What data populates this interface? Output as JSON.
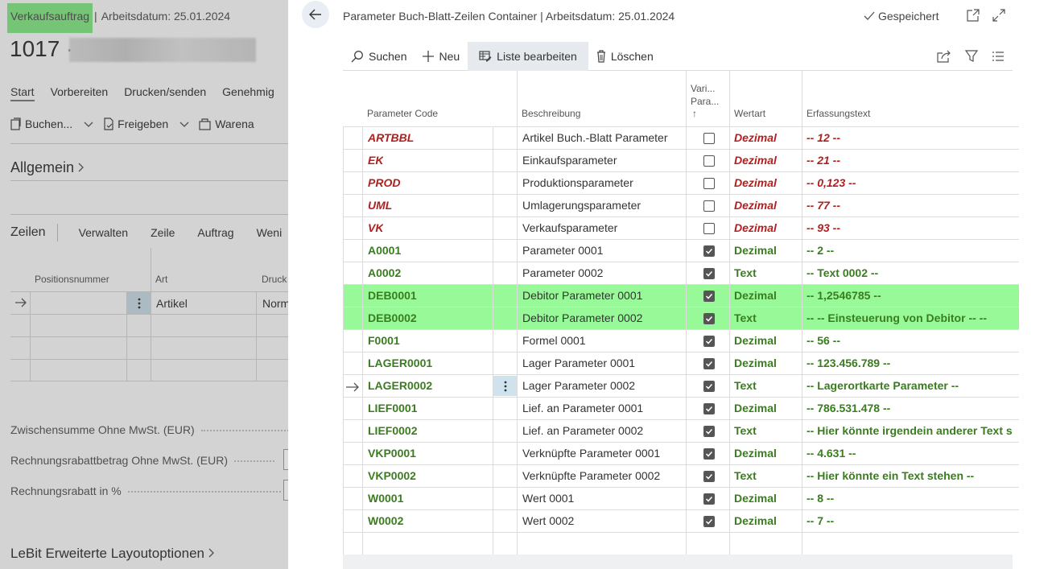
{
  "background": {
    "header_tag": "Verkaufsauftrag",
    "header_rest": "Arbeitsdatum: 25.01.2024",
    "header_sep": "|",
    "doc_number": "1017 ·",
    "tabs": [
      "Start",
      "Vorbereiten",
      "Drucken/senden",
      "Genehmig"
    ],
    "actions": [
      "Buchen...",
      "Freigeben",
      "Warena"
    ],
    "section_general": "Allgemein",
    "lines_title": "Zeilen",
    "lines_actions": [
      "Verwalten",
      "Zeile",
      "Auftrag",
      "Weni"
    ],
    "grid_headers": [
      "Positionsnummer",
      "Art",
      "Druck"
    ],
    "grid_row1_art": "Artikel",
    "grid_row1_druck": "Norm",
    "totals": [
      "Zwischensumme Ohne MwSt. (EUR)",
      "Rechnungsrabattbetrag Ohne MwSt. (EUR)",
      "Rechnungsrabatt in %"
    ],
    "section_layout": "LeBit Erweiterte Layoutoptionen"
  },
  "panel": {
    "title": "Parameter Buch-Blatt-Zeilen Container | Arbeitsdatum: 25.01.2024",
    "saved": "Gespeichert",
    "toolbar": {
      "search": "Suchen",
      "new": "Neu",
      "edit_list": "Liste bearbeiten",
      "delete": "Löschen"
    },
    "columns": {
      "code": "Parameter Code",
      "desc": "Beschreibung",
      "var_line1": "Vari...",
      "var_line2": "Para...",
      "var_sort": "↑",
      "wertart": "Wertart",
      "erfassung": "Erfassungstext"
    },
    "rows": [
      {
        "code": "ARTBBL",
        "desc": "Artikel Buch.-Blatt Parameter",
        "checked": false,
        "wertart": "Dezimal",
        "erf": "-- 12 --",
        "style": "red",
        "selected": false,
        "current": false
      },
      {
        "code": "EK",
        "desc": "Einkaufsparameter",
        "checked": false,
        "wertart": "Dezimal",
        "erf": "-- 21 --",
        "style": "red",
        "selected": false,
        "current": false
      },
      {
        "code": "PROD",
        "desc": "Produktionsparameter",
        "checked": false,
        "wertart": "Dezimal",
        "erf": "-- 0,123 --",
        "style": "red",
        "selected": false,
        "current": false
      },
      {
        "code": "UML",
        "desc": "Umlagerungsparameter",
        "checked": false,
        "wertart": "Dezimal",
        "erf": "-- 77 --",
        "style": "red",
        "selected": false,
        "current": false
      },
      {
        "code": "VK",
        "desc": "Verkaufsparameter",
        "checked": false,
        "wertart": "Dezimal",
        "erf": "-- 93 --",
        "style": "red",
        "selected": false,
        "current": false
      },
      {
        "code": "A0001",
        "desc": "Parameter 0001",
        "checked": true,
        "wertart": "Dezimal",
        "erf": "-- 2 --",
        "style": "green",
        "selected": false,
        "current": false
      },
      {
        "code": "A0002",
        "desc": "Parameter 0002",
        "checked": true,
        "wertart": "Text",
        "erf": "-- Text 0002 --",
        "style": "green",
        "selected": false,
        "current": false
      },
      {
        "code": "DEB0001",
        "desc": "Debitor Parameter 0001",
        "checked": true,
        "wertart": "Dezimal",
        "erf": "-- 1,2546785 --",
        "style": "green",
        "selected": true,
        "current": false
      },
      {
        "code": "DEB0002",
        "desc": "Debitor Parameter 0002",
        "checked": true,
        "wertart": "Text",
        "erf": "-- -- Einsteuerung von Debitor -- --",
        "style": "green",
        "selected": true,
        "current": false
      },
      {
        "code": "F0001",
        "desc": "Formel 0001",
        "checked": true,
        "wertart": "Dezimal",
        "erf": "-- 56 --",
        "style": "green",
        "selected": false,
        "current": false
      },
      {
        "code": "LAGER0001",
        "desc": "Lager Parameter 0001",
        "checked": true,
        "wertart": "Dezimal",
        "erf": "-- 123.456.789 --",
        "style": "green",
        "selected": false,
        "current": false
      },
      {
        "code": "LAGER0002",
        "desc": "Lager Parameter 0002",
        "checked": true,
        "wertart": "Text",
        "erf": "-- Lagerortkarte Parameter --",
        "style": "green",
        "selected": false,
        "current": true
      },
      {
        "code": "LIEF0001",
        "desc": "Lief. an Parameter 0001",
        "checked": true,
        "wertart": "Dezimal",
        "erf": "-- 786.531.478 --",
        "style": "green",
        "selected": false,
        "current": false
      },
      {
        "code": "LIEF0002",
        "desc": "Lief. an Parameter 0002",
        "checked": true,
        "wertart": "Text",
        "erf": "-- Hier könnte irgendein anderer Text s",
        "style": "green",
        "selected": false,
        "current": false
      },
      {
        "code": "VKP0001",
        "desc": "Verknüpfte Parameter 0001",
        "checked": true,
        "wertart": "Dezimal",
        "erf": "-- 4.631 --",
        "style": "green",
        "selected": false,
        "current": false
      },
      {
        "code": "VKP0002",
        "desc": "Verknüpfte Parameter 0002",
        "checked": true,
        "wertart": "Text",
        "erf": "-- Hier könnte ein Text stehen --",
        "style": "green",
        "selected": false,
        "current": false
      },
      {
        "code": "W0001",
        "desc": "Wert 0001",
        "checked": true,
        "wertart": "Dezimal",
        "erf": "-- 8 --",
        "style": "green",
        "selected": false,
        "current": false
      },
      {
        "code": "W0002",
        "desc": "Wert 0002",
        "checked": true,
        "wertart": "Dezimal",
        "erf": "-- 7 --",
        "style": "green",
        "selected": false,
        "current": false
      }
    ]
  },
  "colors": {
    "accent_green": "#83e283",
    "selected_row": "#98f998",
    "red_text": "#b21f1f",
    "green_text": "#3a7d1e"
  }
}
